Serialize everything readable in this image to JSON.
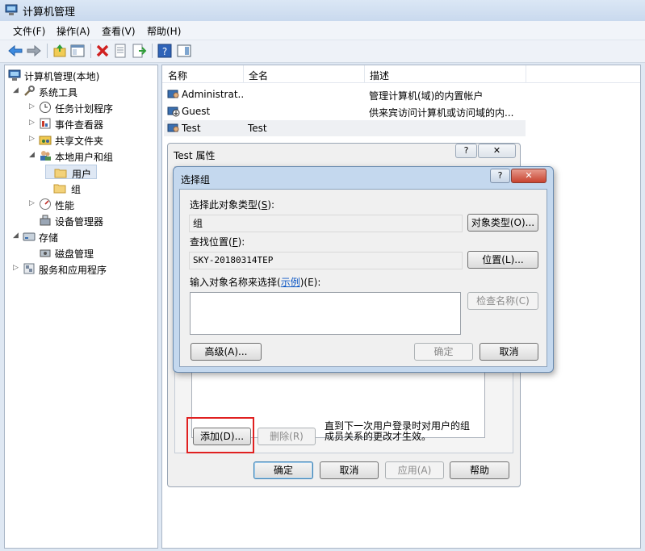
{
  "window": {
    "title": "计算机管理"
  },
  "menu": [
    "文件(F)",
    "操作(A)",
    "查看(V)",
    "帮助(H)"
  ],
  "toolbar": {
    "icons": [
      "back-arrow-icon",
      "forward-arrow-icon",
      "up-folder-icon",
      "console-tree-icon",
      "delete-icon",
      "properties-icon",
      "export-icon",
      "help-icon",
      "panel-icon"
    ]
  },
  "tree": {
    "root": "计算机管理(本地)",
    "system_tools": "系统工具",
    "task_scheduler": "任务计划程序",
    "event_viewer": "事件查看器",
    "shared_folders": "共享文件夹",
    "local_users_groups": "本地用户和组",
    "users": "用户",
    "groups": "组",
    "performance": "性能",
    "device_manager": "设备管理器",
    "storage": "存储",
    "disk_management": "磁盘管理",
    "services_apps": "服务和应用程序"
  },
  "list": {
    "columns": [
      "名称",
      "全名",
      "描述"
    ],
    "rows": [
      {
        "name": "Administrat...",
        "fullname": "",
        "desc": "管理计算机(域)的内置帐户"
      },
      {
        "name": "Guest",
        "fullname": "",
        "desc": "供来宾访问计算机或访问域的内..."
      },
      {
        "name": "Test",
        "fullname": "Test",
        "desc": ""
      }
    ]
  },
  "props": {
    "title": "Test 属性",
    "help_label": "?",
    "close_label": "✕",
    "add_label": "添加(D)...",
    "remove_label": "删除(R)",
    "note_line1": "直到下一次用户登录时对用户的组",
    "note_line2": "成员关系的更改才生效。",
    "ok_label": "确定",
    "cancel_label": "取消",
    "apply_label": "应用(A)",
    "help_button_label": "帮助"
  },
  "select_dialog": {
    "title": "选择组",
    "help_label": "?",
    "close_label": "✕",
    "object_type_label_pre": "选择此对象类型(",
    "object_type_label_key": "S",
    "object_type_label_post": "):",
    "object_type_value": "组",
    "object_type_button": "对象类型(O)...",
    "location_label_pre": "查找位置(",
    "location_label_key": "F",
    "location_label_post": "):",
    "location_value": "SKY-20180314TEP",
    "location_button": "位置(L)...",
    "enter_label_pre": "输入对象名称来选择(",
    "enter_label_link": "示例",
    "enter_label_post": ")(E):",
    "check_names_button": "检查名称(C)",
    "advanced_button": "高级(A)...",
    "ok_button": "确定",
    "cancel_button": "取消"
  }
}
